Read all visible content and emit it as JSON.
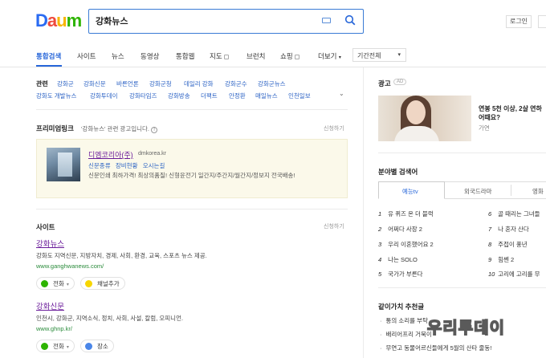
{
  "header": {
    "logo": {
      "d": "D",
      "a": "a",
      "u": "u",
      "m": "m"
    },
    "search_value": "강화뉴스",
    "login_label": "로그인"
  },
  "tabs": {
    "items": [
      "통합검색",
      "사이트",
      "뉴스",
      "동영상",
      "통합웹",
      "지도",
      "브런치",
      "쇼핑",
      "더보기"
    ],
    "date_filter": "기간전체"
  },
  "related": {
    "label": "관련",
    "row1": [
      "강화군",
      "강화신문",
      "바른언론",
      "강화군청",
      "데일리 강화",
      "강화군수",
      "강화군뉴스"
    ],
    "row2": [
      "강화도 개발뉴스",
      "강화투데이",
      "강화타임즈",
      "강화방송",
      "더팩트",
      "안정환",
      "매일뉴스",
      "인천일보"
    ]
  },
  "premium": {
    "title": "프리미엄링크",
    "subtitle": "'강화뉴스' 관련 광고입니다.",
    "right": "신청하기",
    "ad": {
      "title": "디엠코리아(주)",
      "url": "dmkorea.kr",
      "links": [
        "신문종류",
        "장비현황",
        "오시는길"
      ],
      "desc": "신문인쇄 최하가격! 최상의품질! 신형윤전기 일간지/주간지/월간지/정보지 전국배송!"
    }
  },
  "sites": {
    "title": "사이트",
    "right": "신청하기",
    "items": [
      {
        "name": "강화뉴스",
        "desc": "강화도 지역신문, 지방자치, 경제, 사회, 환경, 교육, 스포츠 뉴스 제공.",
        "url": "www.ganghwanews.com/",
        "btn1": "전화",
        "btn2": "채널추가"
      },
      {
        "name": "강화신문",
        "desc": "인천시, 강화군, 지역소식, 정치, 사회, 사설, 칼럼, 오피니언.",
        "url": "www.ghnp.kr/",
        "btn1": "전화",
        "btn2": "장소"
      }
    ]
  },
  "right_ad": {
    "title": "광고",
    "badge": "AD",
    "text_line1": "연봉 5천 이상, 2살 연하",
    "text_line2": "어때요?",
    "sub": "가연"
  },
  "field_search": {
    "title": "분야별 검색어",
    "tabs": [
      "예능tv",
      "외국드라마",
      "영화"
    ],
    "left": [
      {
        "n": "1",
        "t": "유 퀴즈 온 더 블럭"
      },
      {
        "n": "2",
        "t": "어쩌다 사장 2"
      },
      {
        "n": "3",
        "t": "우리 이혼했어요 2"
      },
      {
        "n": "4",
        "t": "나는 SOLO"
      },
      {
        "n": "5",
        "t": "국가가 부른다"
      }
    ],
    "right": [
      {
        "n": "6",
        "t": "골 때리는 그녀들"
      },
      {
        "n": "7",
        "t": "나 혼자 산다"
      },
      {
        "n": "8",
        "t": "주접이 풍년"
      },
      {
        "n": "9",
        "t": "힘쎈 2"
      },
      {
        "n": "10",
        "t": "고리에 고리를 무"
      }
    ]
  },
  "value_rec": {
    "title": "같이가치 추천글",
    "items": [
      "통의 소리를 부탁",
      "배리어프리 거북이",
      "무연고 동물어르신들에게 5월의 산타 줄동!"
    ]
  },
  "watermark": "우리투데이",
  "colors": {
    "accent": "#2766d9",
    "visited": "#6a1b9a",
    "url_green": "#2a8b3b"
  }
}
